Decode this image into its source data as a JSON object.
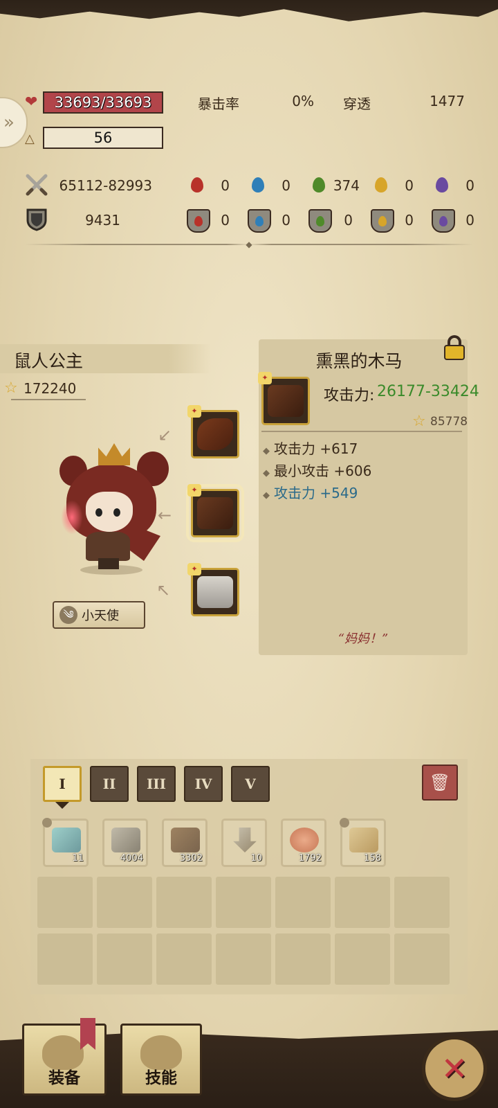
{
  "stats": {
    "hp": "33693/33693",
    "level": "56",
    "crit_label": "暴击率",
    "crit_value": "0%",
    "pierce_label": "穿透",
    "pierce_value": "1477",
    "attack_range": "65112-82993",
    "defense": "9431",
    "attack_elements": [
      "0",
      "0",
      "374",
      "0",
      "0"
    ],
    "defense_elements": [
      "0",
      "0",
      "0",
      "0",
      "0"
    ],
    "element_colors": [
      "#b8322a",
      "#2f7fb8",
      "#4f8a2a",
      "#d7a52a",
      "#6a4aa0"
    ]
  },
  "character": {
    "name": "鼠人公主",
    "score": "172240",
    "title_button": "小天使"
  },
  "item": {
    "name": "熏黑的木马",
    "attack_label": "攻击力:",
    "attack_value": "26177-33424",
    "score": "85778",
    "bonuses": [
      "攻击力 +617",
      "最小攻击 +606",
      "攻击力 +549"
    ],
    "quote": "“妈妈！”",
    "locked": true
  },
  "inventory": {
    "tabs": [
      "I",
      "II",
      "III",
      "IV",
      "V"
    ],
    "active_tab": "I",
    "materials": [
      {
        "icon": "crystal-ore-icon",
        "count": "11"
      },
      {
        "icon": "stone-blocks-icon",
        "count": "4004"
      },
      {
        "icon": "ore-crate-icon",
        "count": "3302"
      },
      {
        "icon": "shovel-icon",
        "count": "10"
      },
      {
        "icon": "food-bowl-icon",
        "count": "1792"
      },
      {
        "icon": "treasure-map-icon",
        "count": "158"
      }
    ]
  },
  "nav": {
    "equip_label": "装备",
    "skill_label": "技能"
  }
}
